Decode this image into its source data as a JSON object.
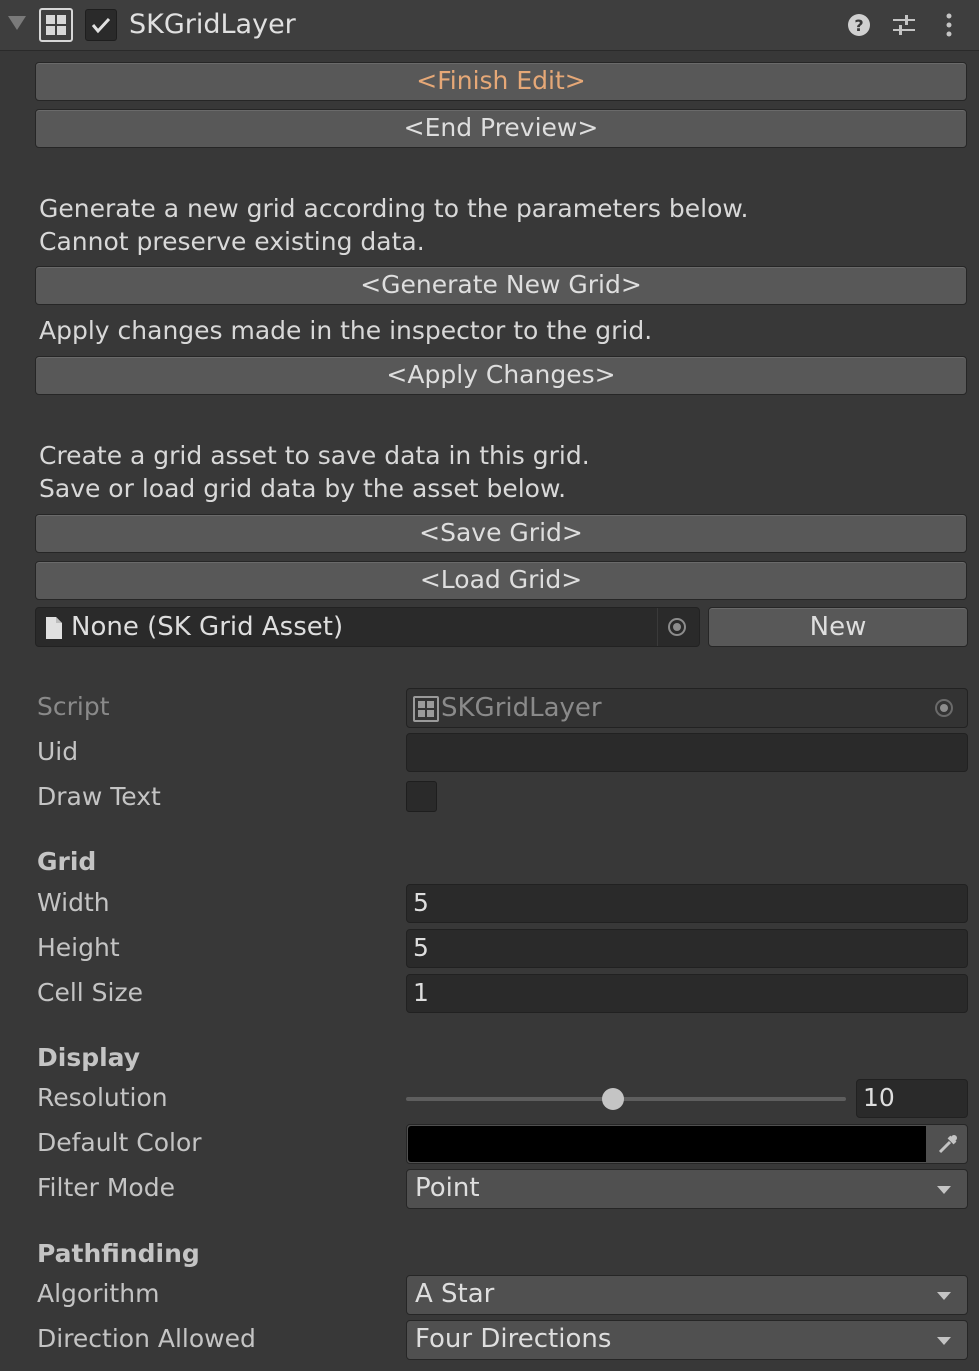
{
  "header": {
    "component_name": "SKGridLayer",
    "icons": [
      "foldout-arrow-icon",
      "grid-component-icon",
      "enabled-checkbox-icon",
      "help-icon",
      "preset-icon",
      "more-menu-icon"
    ]
  },
  "buttons": {
    "finish_edit": "<Finish Edit>",
    "end_preview": "<End Preview>",
    "generate_new_grid": "<Generate New Grid>",
    "apply_changes": "<Apply Changes>",
    "save_grid": "<Save Grid>",
    "load_grid": "<Load Grid>",
    "new": "New"
  },
  "help_text": {
    "generate_line1": "Generate a new grid according to the parameters below.",
    "generate_line2": "Cannot preserve existing data.",
    "apply": "Apply changes made in the inspector to the grid.",
    "asset_line1": "Create a grid asset to save data in this grid.",
    "asset_line2": "Save or load grid data by the asset below."
  },
  "asset_field": {
    "value": "None (SK Grid Asset)"
  },
  "properties": {
    "script": {
      "label": "Script",
      "value": "SKGridLayer"
    },
    "uid": {
      "label": "Uid",
      "value": ""
    },
    "draw_text": {
      "label": "Draw Text",
      "checked": false
    }
  },
  "grid_section": {
    "header": "Grid",
    "width": {
      "label": "Width",
      "value": "5"
    },
    "height": {
      "label": "Height",
      "value": "5"
    },
    "cell_size": {
      "label": "Cell Size",
      "value": "1"
    }
  },
  "display_section": {
    "header": "Display",
    "resolution": {
      "label": "Resolution",
      "value": "10",
      "slider_fraction": 0.47
    },
    "default_color": {
      "label": "Default Color",
      "color": "#000000"
    },
    "filter_mode": {
      "label": "Filter Mode",
      "value": "Point"
    }
  },
  "pathfinding_section": {
    "header": "Pathfinding",
    "algorithm": {
      "label": "Algorithm",
      "value": "A Star"
    },
    "direction_allowed": {
      "label": "Direction Allowed",
      "value": "Four Directions"
    }
  },
  "colors": {
    "background": "#383838",
    "accent_orange": "#e6a877",
    "button": "#585858",
    "field": "#2a2a2a"
  }
}
